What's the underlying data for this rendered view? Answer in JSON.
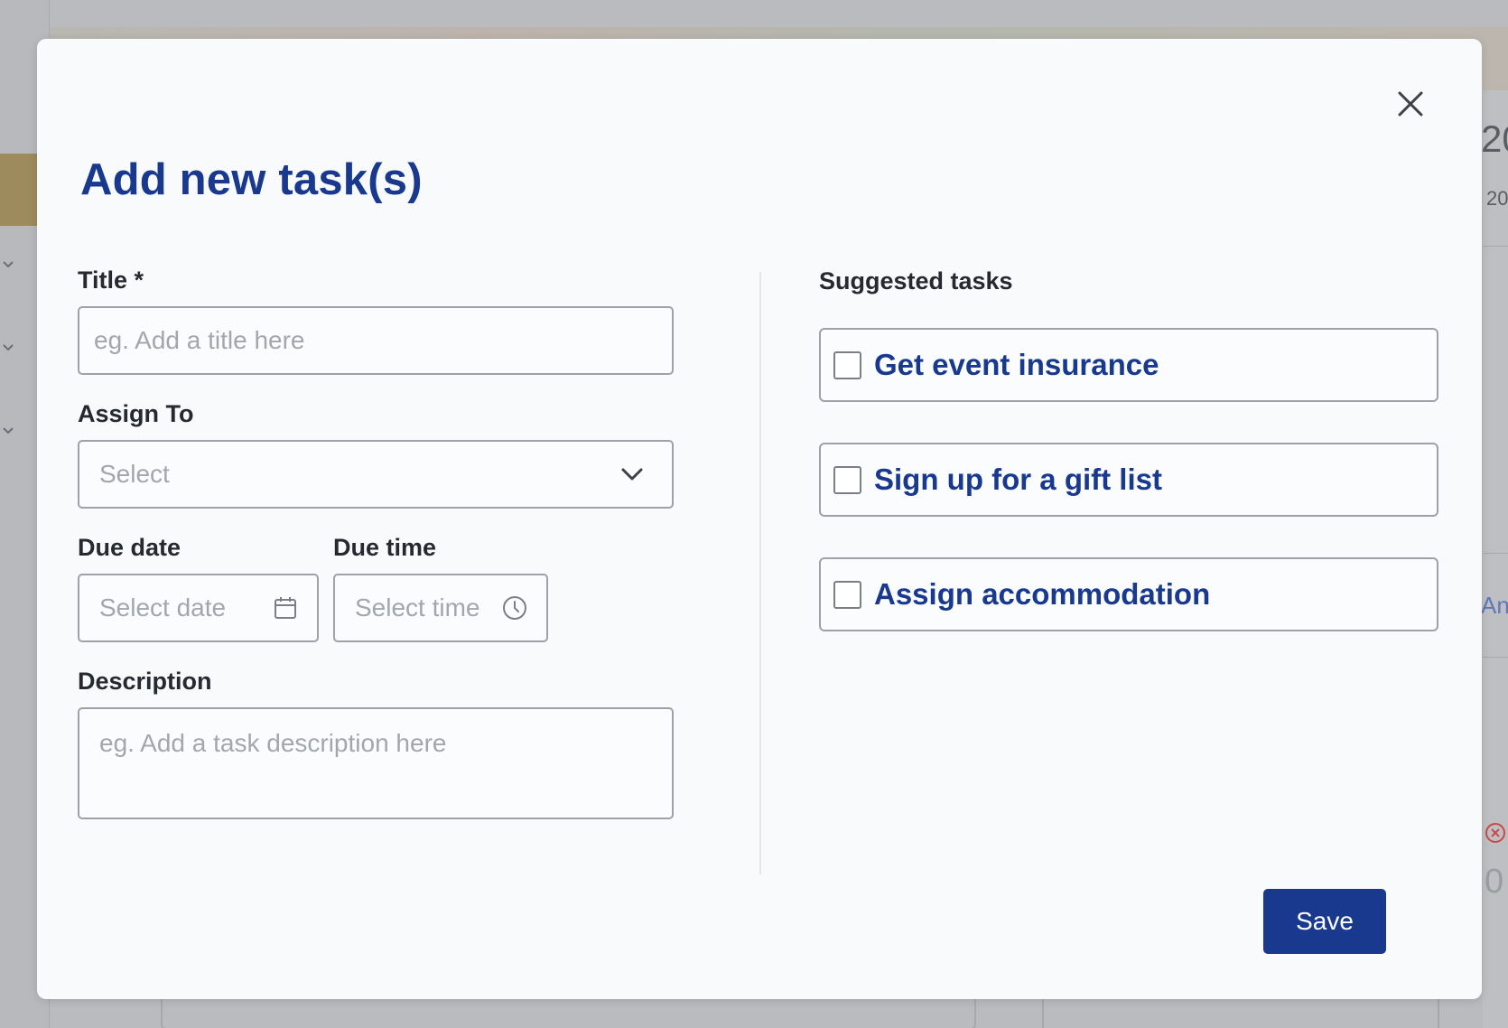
{
  "backdrop": {
    "right_text_1": "20",
    "right_text_2": "20",
    "right_text_3": "An",
    "right_text_4": "0",
    "right_bottom_text": "o"
  },
  "modal": {
    "title": "Add new task(s)",
    "close_icon": "close-icon"
  },
  "form": {
    "title_label": "Title *",
    "title_placeholder": "eg. Add a title here",
    "assign_label": "Assign To",
    "assign_value": "Select",
    "due_date_label": "Due date",
    "due_date_placeholder": "Select date",
    "due_time_label": "Due time",
    "due_time_placeholder": "Select time",
    "description_label": "Description",
    "description_placeholder": "eg. Add a task description here"
  },
  "suggested": {
    "heading": "Suggested tasks",
    "items": [
      {
        "label": "Get event insurance",
        "checked": false
      },
      {
        "label": "Sign up for a gift list",
        "checked": false
      },
      {
        "label": "Assign accommodation",
        "checked": false
      }
    ]
  },
  "actions": {
    "save_label": "Save"
  },
  "colors": {
    "brand": "#18398e",
    "error": "#d64545"
  }
}
